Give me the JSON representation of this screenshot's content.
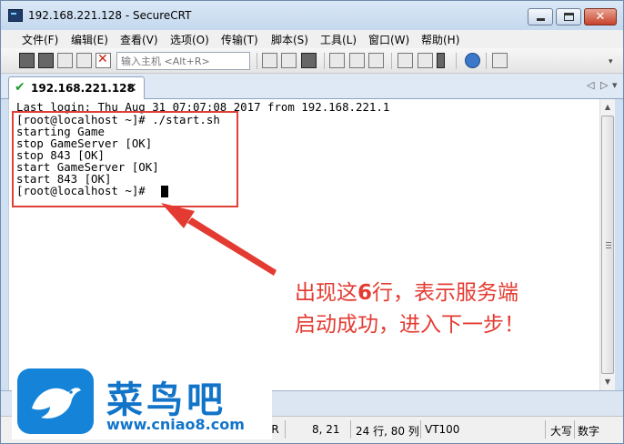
{
  "window": {
    "title": "192.168.221.128 - SecureCRT",
    "controls": {
      "close_glyph": "✕"
    }
  },
  "menu": [
    "文件(F)",
    "编辑(E)",
    "查看(V)",
    "选项(O)",
    "传输(T)",
    "脚本(S)",
    "工具(L)",
    "窗口(W)",
    "帮助(H)"
  ],
  "toolbar": {
    "quick_connect_placeholder": "输入主机 <Alt+R>",
    "overflow_glyph": "▾"
  },
  "tabs": [
    {
      "label": "192.168.221.128",
      "close_glyph": "✕",
      "status": "connected",
      "status_glyph": "✔",
      "status_color": "#1e9b2e"
    }
  ],
  "tab_nav": {
    "prev": "◁",
    "next": "▷",
    "menu": "▾"
  },
  "terminal": {
    "lines": [
      "Last login: Thu Aug 31 07:07:08 2017 from 192.168.221.1",
      "[root@localhost ~]# ./start.sh",
      "starting Game",
      "stop GameServer [OK]",
      "stop 843 [OK]",
      "start GameServer [OK]",
      "start 843 [OK]",
      "[root@localhost ~]# "
    ]
  },
  "scrollbar": {
    "up": "▲",
    "down": "▼"
  },
  "annotation": {
    "line1_pre": "出现这",
    "line1_num": "6",
    "line1_post": "行，表示服务端",
    "line2": "启动成功，进入下一步！",
    "color": "#e33b32"
  },
  "status": {
    "protocol_fragment": "TR",
    "cursor_pos": "8,  21",
    "size": "24 行, 80 列",
    "terminal_type": "VT100",
    "caps": "大写",
    "num": "数字"
  },
  "watermark": {
    "name": "菜鸟吧",
    "url": "www.cniao8.com",
    "color": "#1274c9"
  }
}
